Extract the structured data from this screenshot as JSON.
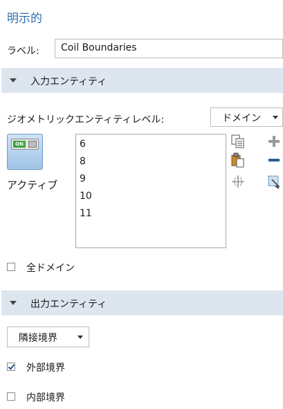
{
  "title": "明示的",
  "label_field": {
    "label": "ラベル:",
    "value": "Coil Boundaries"
  },
  "input_section": {
    "label": "入力エンティティ"
  },
  "geometry_level": {
    "label": "ジオメトリックエンティティレベル:",
    "selected": "ドメイン"
  },
  "active_toggle": {
    "state_text": "ON",
    "label": "アクティブ"
  },
  "selection_list": [
    "6",
    "8",
    "9",
    "10",
    "11"
  ],
  "all_domains": {
    "label": "全ドメイン",
    "checked": false
  },
  "output_section": {
    "label": "出力エンティティ"
  },
  "output_dropdown": {
    "selected": "隣接境界"
  },
  "exterior_boundaries": {
    "label": "外部境界",
    "checked": true
  },
  "interior_boundaries": {
    "label": "内部境界",
    "checked": false
  },
  "icons": [
    "copy-icon",
    "paste-icon",
    "zoom-to-selection-icon",
    "add-icon",
    "remove-icon",
    "clear-selection-icon"
  ],
  "colors": {
    "title": "#2e6dac",
    "section_bg": "#dde6ef",
    "add_icon": "#9a9a9a",
    "remove_icon": "#2b5d94"
  }
}
